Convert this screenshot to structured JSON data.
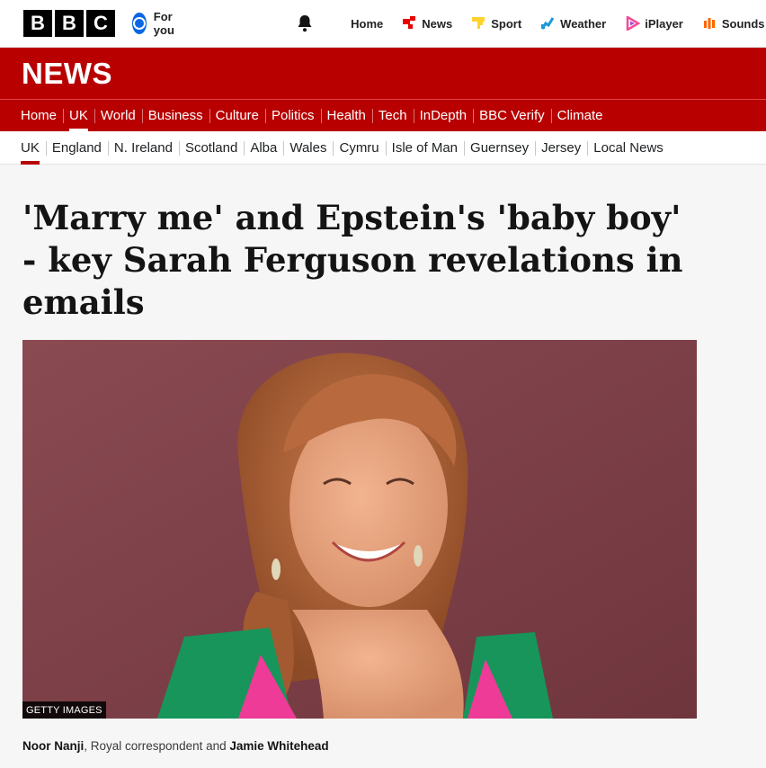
{
  "header": {
    "logo_letters": [
      "B",
      "B",
      "C"
    ],
    "for_you": "For you",
    "icons": {
      "bell": "bell-icon",
      "for_you": "user-circle-icon"
    },
    "nav": [
      {
        "label": "Home",
        "icon": "none"
      },
      {
        "label": "News",
        "icon": "news-icon",
        "color": "#e60000"
      },
      {
        "label": "Sport",
        "icon": "sport-icon",
        "color": "#ffd230"
      },
      {
        "label": "Weather",
        "icon": "weather-icon",
        "color": "#1a9ad6"
      },
      {
        "label": "iPlayer",
        "icon": "iplayer-icon",
        "color": "#f54997"
      },
      {
        "label": "Sounds",
        "icon": "sounds-icon",
        "color": "#ff6600"
      }
    ]
  },
  "section": {
    "title": "NEWS",
    "brand_color": "#b80000"
  },
  "main_nav": [
    "Home",
    "UK",
    "World",
    "Business",
    "Culture",
    "Politics",
    "Health",
    "Tech",
    "InDepth",
    "BBC Verify",
    "Climate"
  ],
  "main_nav_active": "UK",
  "sub_nav": [
    "UK",
    "England",
    "N. Ireland",
    "Scotland",
    "Alba",
    "Wales",
    "Cymru",
    "Isle of Man",
    "Guernsey",
    "Jersey",
    "Local News"
  ],
  "sub_nav_active": "UK",
  "article": {
    "headline": "'Marry me' and Epstein's 'baby boy' - key Sarah Ferguson revelations in emails",
    "image_credit": "GETTY IMAGES",
    "byline": {
      "author1": "Noor Nanji",
      "role": ", Royal correspondent and ",
      "author2": "Jamie Whitehead"
    }
  }
}
